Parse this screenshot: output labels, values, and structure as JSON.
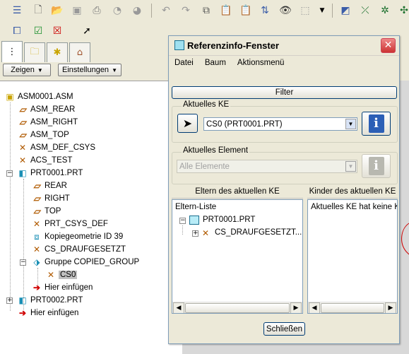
{
  "toolbar": {
    "row1_icons": [
      "select-list-icon",
      "new-icon",
      "open-icon",
      "save-icon",
      "print-icon",
      "send-icon",
      "send-icon-2",
      "undo-icon",
      "redo-icon",
      "copy-icon",
      "paste-icon",
      "paste-special-icon",
      "regenerate-icon",
      "find-icon",
      "select-box-icon",
      "dropdown-icon",
      "datum-plane-icon",
      "datum-axis-icon",
      "datum-csys-icon",
      "datum-point-icon"
    ],
    "row2_icons": [
      "window-activate-icon",
      "window-check-icon",
      "window-close-icon",
      "context-help-icon"
    ]
  },
  "left_panel": {
    "tabs": [
      "model-tree-tab",
      "folder-browser-tab",
      "favorites-tab",
      "connections-tab"
    ],
    "show_button": "Zeigen",
    "settings_button": "Einstellungen",
    "tree": [
      {
        "label": "ASM0001.ASM"
      },
      {
        "label": "ASM_REAR"
      },
      {
        "label": "ASM_RIGHT"
      },
      {
        "label": "ASM_TOP"
      },
      {
        "label": "ASM_DEF_CSYS"
      },
      {
        "label": "ACS_TEST"
      },
      {
        "label": "PRT0001.PRT"
      },
      {
        "label": "REAR"
      },
      {
        "label": "RIGHT"
      },
      {
        "label": "TOP"
      },
      {
        "label": "PRT_CSYS_DEF"
      },
      {
        "label": "Kopiegeometrie ID 39"
      },
      {
        "label": "CS_DRAUFGESETZT"
      },
      {
        "label": "Gruppe COPIED_GROUP"
      },
      {
        "label": "CS0"
      },
      {
        "label": "Hier einfügen"
      },
      {
        "label": "PRT0002.PRT"
      },
      {
        "label": "Hier einfügen"
      }
    ]
  },
  "dialog": {
    "title": "Referenzinfo-Fenster",
    "menu": [
      "Datei",
      "Baum",
      "Aktionsmenü"
    ],
    "filter_button": "Filter",
    "current_feature_group": "Aktuelles KE",
    "current_feature_value": "CS0 (PRT0001.PRT)",
    "current_element_group": "Aktuelles Element",
    "current_element_value": "Alle Elemente",
    "parents_header": "Eltern des aktuellen KE",
    "children_header": "Kinder des aktuellen KE",
    "parents_list_title": "Eltern-Liste",
    "parents_items": [
      "PRT0001.PRT",
      "CS_DRAUFGESETZT..."
    ],
    "children_text": "Aktuelles KE hat keine K",
    "close_button": "Schließen"
  }
}
